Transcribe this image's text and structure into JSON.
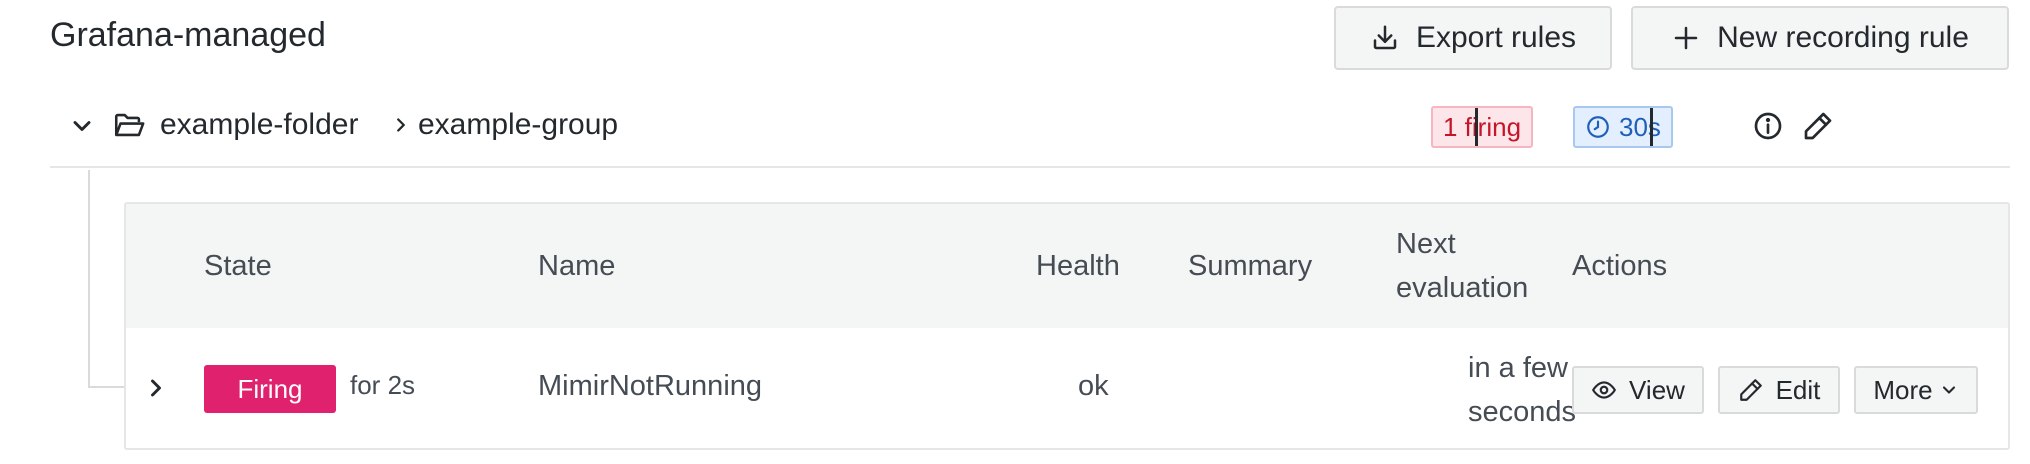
{
  "header": {
    "title": "Grafana-managed",
    "export_label": "Export rules",
    "new_rule_label": "New recording rule"
  },
  "group": {
    "folder": "example-folder",
    "name": "example-group",
    "firing_badge": "1 firing",
    "interval": "30s"
  },
  "table": {
    "columns": {
      "state": "State",
      "name": "Name",
      "health": "Health",
      "summary": "Summary",
      "next_eval_line1": "Next",
      "next_eval_line2": "evaluation",
      "actions": "Actions"
    },
    "rows": [
      {
        "state": "Firing",
        "state_duration": "for 2s",
        "name": "MimirNotRunning",
        "health": "ok",
        "summary": "",
        "next_eval_line1": "in a few",
        "next_eval_line2": "seconds",
        "view_label": "View",
        "edit_label": "Edit",
        "more_label": "More"
      }
    ]
  },
  "colors": {
    "firing": "#e0226e",
    "firing_badge_bg": "#fde6ea",
    "interval_badge_bg": "#e3efff"
  }
}
